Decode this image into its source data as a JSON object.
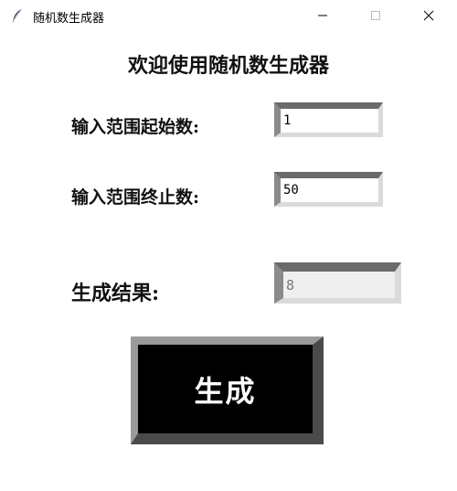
{
  "window": {
    "title": "随机数生成器",
    "icon": "feather-icon"
  },
  "heading": "欢迎使用随机数生成器",
  "form": {
    "start_label": "输入范围起始数:",
    "start_value": "1",
    "end_label": "输入范围终止数:",
    "end_value": "50",
    "result_label": "生成结果:",
    "result_value": "8"
  },
  "button": {
    "label": "生成",
    "background": "#000000",
    "text_color": "#ffffff"
  }
}
